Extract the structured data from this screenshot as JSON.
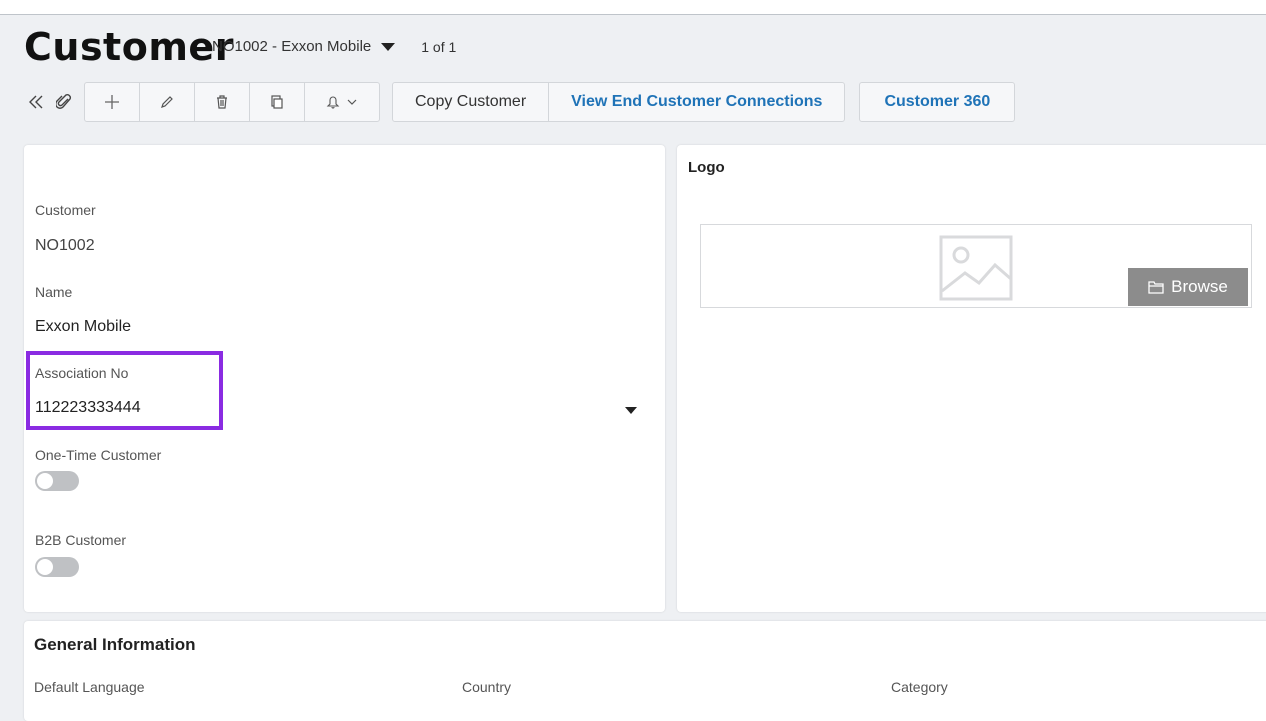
{
  "header": {
    "title": "Customer",
    "record": "NO1002 - Exxon Mobile",
    "count": "1 of 1"
  },
  "toolbar": {
    "collapse_icon": "double-chevron-left-icon",
    "attach_icon": "paperclip-icon",
    "add_icon": "plus-icon",
    "edit_icon": "pencil-icon",
    "delete_icon": "trash-icon",
    "duplicate_icon": "copy-icon",
    "notify_icon": "bell-icon",
    "copy_customer": "Copy Customer",
    "view_connections": "View End Customer Connections",
    "customer_360": "Customer 360"
  },
  "main": {
    "customer_label": "Customer",
    "customer_value": "NO1002",
    "name_label": "Name",
    "name_value": "Exxon Mobile",
    "association_label": "Association No",
    "association_value": "112223333444",
    "one_time_label": "One-Time Customer",
    "one_time_on": false,
    "b2b_label": "B2B Customer",
    "b2b_on": false
  },
  "logo": {
    "title": "Logo",
    "browse_label": "Browse",
    "placeholder_icon": "image-placeholder-icon"
  },
  "general": {
    "title": "General Information",
    "default_language_label": "Default Language",
    "country_label": "Country",
    "category_label": "Category"
  },
  "colors": {
    "accent_link": "#1f73b7",
    "highlight": "#8a2be2",
    "browse_bg": "#8c8c8c"
  }
}
